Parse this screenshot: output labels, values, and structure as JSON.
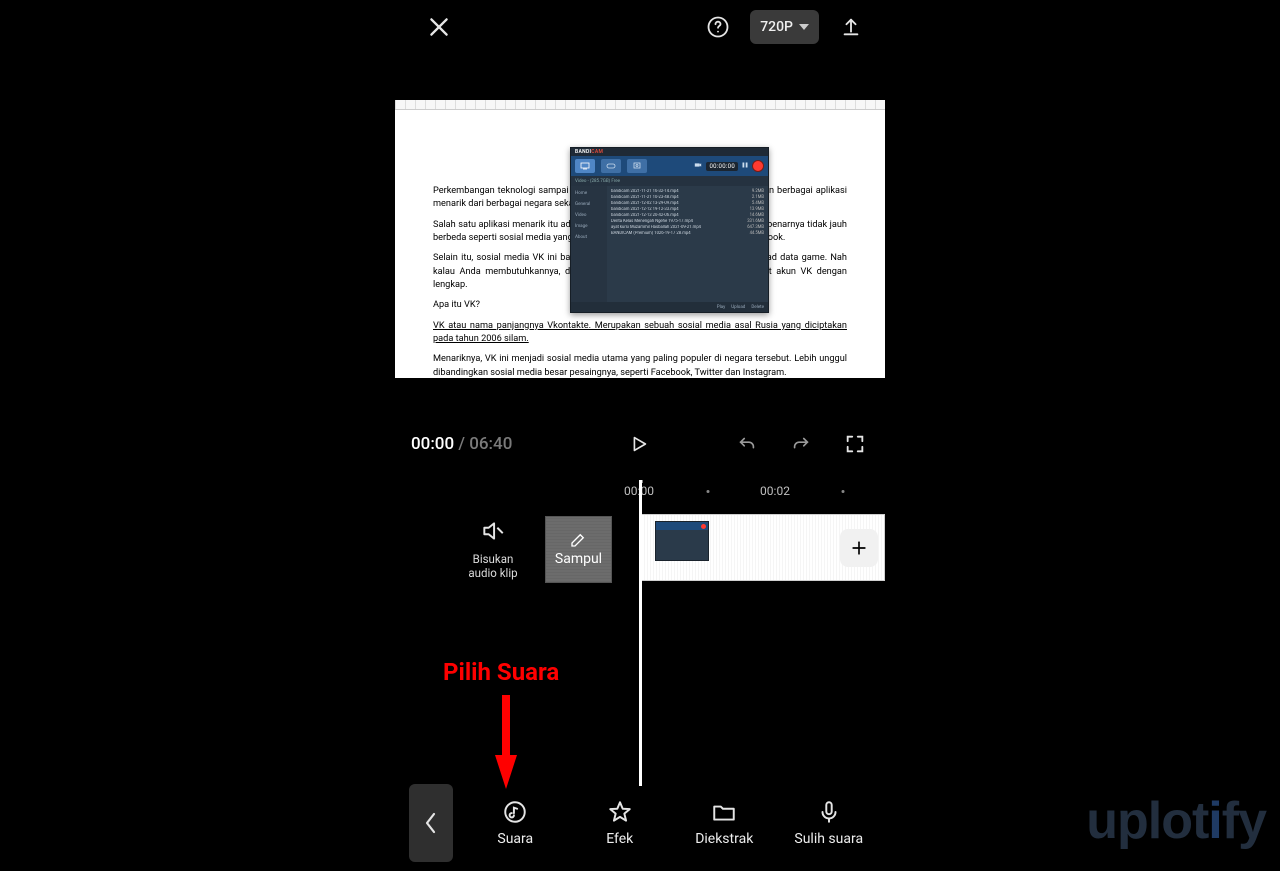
{
  "topbar": {
    "resolution": "720P"
  },
  "preview_document": {
    "paragraphs": [
      "Perkembangan teknologi sampai saat ini terbilang sangat pesat. Kini menciptakan berbagai aplikasi menarik dari berbagai negara sekalipun.",
      "Salah satu aplikasi menarik itu adalah VK. VK sendiri adalah sosial media yang sebenarnya tidak jauh berbeda seperti sosial media yang umum Anda gunakan. Seperti contohnya Facebook.",
      "Selain itu, sosial media VK ini banyak dipakai di kalangan gamers untuk download data game. Nah kalau Anda membutuhkannya, di artikel ini Uplotify akan membahas cara buat akun VK dengan lengkap.",
      "Apa itu VK?",
      "VK atau nama panjangnya Vkontakte. Merupakan sebuah sosial media asal Rusia yang diciptakan pada tahun 2006 silam.",
      "Menariknya, VK ini menjadi sosial media utama yang paling populer di negara tersebut. Lebih unggul dibandingkan sosial media besar pesaingnya, seperti Facebook, Twitter dan Instagram."
    ]
  },
  "bandicam": {
    "brand1": "BANDI",
    "brand2": "CAM",
    "timer": "00:00:00",
    "sub_text": "Video - (285.7GB) Free",
    "side_items": [
      "Home",
      "General",
      "Video",
      "Image",
      "About"
    ],
    "files": [
      {
        "name": "bandicam 2021-11-21 16-32-14.mp4",
        "size": "9.2MB"
      },
      {
        "name": "bandicam 2021-11-21 10-23-48.mp4",
        "size": "2.1MB"
      },
      {
        "name": "bandicam 2021-12-02 13-29-09.mp4",
        "size": "5.4MB"
      },
      {
        "name": "bandicam 2021-12-12 19-12-33.mp4",
        "size": "13.9MB"
      },
      {
        "name": "bandicam 2021-12-13 20-42-06.mp4",
        "size": "14.6MB"
      },
      {
        "name": "Derita Kelas Menengah Ngehe 1975-17.mp4",
        "size": "331.6MB"
      },
      {
        "name": "ayat kursi Muzammil Hasballah 2021-09-21.mp4",
        "size": "647.3MB"
      },
      {
        "name": "BANDICAM (Premium) 1026-19-17 28.mp4",
        "size": "44.5MB"
      }
    ],
    "footer": [
      "Play",
      "Upload",
      "Delete"
    ]
  },
  "playback": {
    "current": "00:00",
    "total": "06:40"
  },
  "timeline": {
    "tick1": "00:00",
    "tick2": "00:02",
    "mute_label_l1": "Bisukan",
    "mute_label_l2": "audio klip",
    "cover_label": "Sampul"
  },
  "annotation": {
    "text": "Pilih Suara"
  },
  "tools": {
    "back": "‹",
    "items": [
      {
        "key": "suara",
        "label": "Suara"
      },
      {
        "key": "efek",
        "label": "Efek"
      },
      {
        "key": "diekstrak",
        "label": "Diekstrak"
      },
      {
        "key": "sulih",
        "label": "Sulih suara"
      }
    ]
  },
  "watermark": {
    "pre": "uplot",
    "i": "i",
    "post": "fy"
  }
}
